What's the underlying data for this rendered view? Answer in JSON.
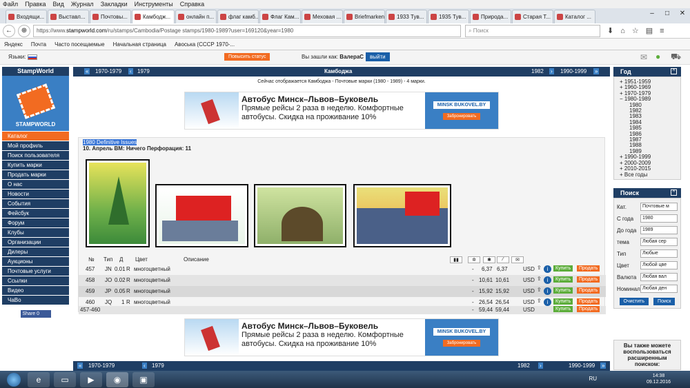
{
  "menubar": {
    "items": [
      "Файл",
      "Правка",
      "Вид",
      "Журнал",
      "Закладки",
      "Инструменты",
      "Справка"
    ]
  },
  "tabs": [
    "Входящи...",
    "Выставл...",
    "Почтовы...",
    "Камбодж...",
    "онлайн п...",
    "флаг камб...",
    "Флаг Кам...",
    "Меховая ...",
    "Briefmarken ...",
    "1933 Тув...",
    "1935 Тув...",
    "Природа...",
    "Старая Т...",
    "Каталог ..."
  ],
  "nav": {
    "url_prefix": "https://www.",
    "url_host": "stampworld.com",
    "url_path": "/ru/stamps/Cambodia/Postage stamps/1980-1989?user=169120&year=1980",
    "search_placeholder": "Поиск"
  },
  "bookmarks": [
    "Яндекс",
    "Почта",
    "Часто посещаемые",
    "Начальная страница",
    "Авоська (СССР 1970-..."
  ],
  "site": {
    "languages_label": "Языки:",
    "upgrade_label": "Повысить статус",
    "logged_as_label": "Вы зашли как:",
    "user": "ВалераС",
    "logout_label": "выйти"
  },
  "left": {
    "title": "StampWorld",
    "logo_text": "STAMPWORLD",
    "menu": [
      "Каталог",
      "Мой профиль",
      "Поиск пользователя",
      "Купить марки",
      "Продать марки",
      "О нас",
      "Новости",
      "События",
      "Фейсбук",
      "Форум",
      "Клубы",
      "Организации",
      "Дилеры",
      "Аукционы",
      "Почтовые услуги",
      "Ссылки",
      "Видео",
      "ЧаВо"
    ],
    "share_label": "Share 0"
  },
  "pagenav": {
    "prev2": "1970-1979",
    "prev1": "1979",
    "title": "Камбоджа",
    "next1": "1982",
    "next2": "1990-1999"
  },
  "subtitle": "Сейчас отображается Камбоджа - Почтовые марки (1980 - 1989) - 4 марки.",
  "ad": {
    "headline": "Автобус Минск–Львов–Буковель",
    "line1": "Прямые рейсы 2 раза в неделю. Комфортные",
    "line2": "автобусы. Скидка на проживание 10%",
    "brand": "MINSK BUKOVEL.BY",
    "button": "Забронировать"
  },
  "issue": {
    "name": "1980 Definitive Issues",
    "details": "10. Апрель ВМ: Ничего   Перфорация: 11"
  },
  "table": {
    "headers": {
      "no": "№",
      "type": "Тип",
      "d": "Д",
      "color": "Цвет",
      "desc": "Описание"
    },
    "rows": [
      {
        "no": "457",
        "type": "JN",
        "value": "0.01",
        "unit": "R",
        "color": "многоцветный",
        "dash": "-",
        "p1": "6,37",
        "p2": "6,37",
        "cur": "USD",
        "buy": "Купить",
        "sell": "Продать"
      },
      {
        "no": "458",
        "type": "JO",
        "value": "0.02",
        "unit": "R",
        "color": "многоцветный",
        "dash": "-",
        "p1": "10,61",
        "p2": "10,61",
        "cur": "USD",
        "buy": "Купить",
        "sell": "Продать"
      },
      {
        "no": "459",
        "type": "JP",
        "value": "0.05",
        "unit": "R",
        "color": "многоцветный",
        "dash": "-",
        "p1": "15,92",
        "p2": "15,92",
        "cur": "USD",
        "buy": "Купить",
        "sell": "Продать"
      },
      {
        "no": "460",
        "type": "JQ",
        "value": "1",
        "unit": "R",
        "color": "многоцветный",
        "dash": "-",
        "p1": "26,54",
        "p2": "26,54",
        "cur": "USD",
        "buy": "Купить",
        "sell": "Продать"
      }
    ],
    "total": {
      "range": "457-460",
      "dash": "-",
      "p1": "59,44",
      "p2": "59,44",
      "cur": "USD",
      "buy": "Купить",
      "sell": "Продать"
    }
  },
  "botnav": {
    "prev2": "1970-1979",
    "prev1": "1979",
    "next1": "1982",
    "next2": "1990-1999"
  },
  "year": {
    "title": "Год",
    "decades": [
      "1951-1959",
      "1960-1969",
      "1970-1979",
      "1980-1989"
    ],
    "years": [
      "1980",
      "1982",
      "1983",
      "1984",
      "1985",
      "1986",
      "1987",
      "1988",
      "1989"
    ],
    "more": [
      "1990-1999",
      "2000-2009",
      "2010-2015",
      "Все годы"
    ]
  },
  "searchpanel": {
    "title": "Поиск",
    "fields": [
      {
        "label": "Кат.",
        "value": "Почтовые м"
      },
      {
        "label": "С года",
        "value": "1980"
      },
      {
        "label": "До года",
        "value": "1989"
      },
      {
        "label": "тема",
        "value": "Любая сер"
      },
      {
        "label": "Тип",
        "value": "Любые"
      },
      {
        "label": "Цвет",
        "value": "Любой цве"
      },
      {
        "label": "Валюта",
        "value": "Любая вал"
      },
      {
        "label": "Номинал",
        "value": "Любая ден"
      }
    ],
    "clear": "Очистить",
    "search": "Поиск"
  },
  "adv": {
    "line1": "Вы также можете",
    "line2": "воспользоваться",
    "line3": "расширенным",
    "line4": "поиском:"
  },
  "taskbar": {
    "lang": "RU",
    "time": "14:38",
    "date": "09.12.2016"
  }
}
